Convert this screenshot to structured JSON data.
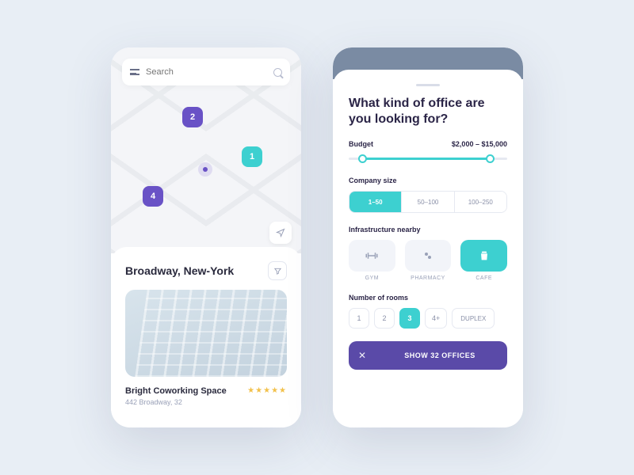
{
  "left": {
    "search_placeholder": "Search",
    "pins": {
      "a": "2",
      "b": "1",
      "c": "4"
    },
    "location_title": "Broadway, New-York",
    "listing": {
      "name": "Bright Coworking Space",
      "address": "442 Broadway, 32",
      "stars": "★★★★★"
    }
  },
  "right": {
    "heading": "What kind of office are you looking for?",
    "budget": {
      "label": "Budget",
      "value": "$2,000 – $15,000"
    },
    "company_size": {
      "label": "Company size",
      "options": [
        "1–50",
        "50–100",
        "100–250"
      ],
      "selected": 0
    },
    "infra": {
      "label": "Infrastructure nearby",
      "items": [
        "GYM",
        "PHARMACY",
        "CAFE"
      ],
      "selected": 2
    },
    "rooms": {
      "label": "Number of rooms",
      "options": [
        "1",
        "2",
        "3",
        "4+",
        "DUPLEX"
      ],
      "selected": 2
    },
    "cta": "SHOW 32 OFFICES"
  }
}
